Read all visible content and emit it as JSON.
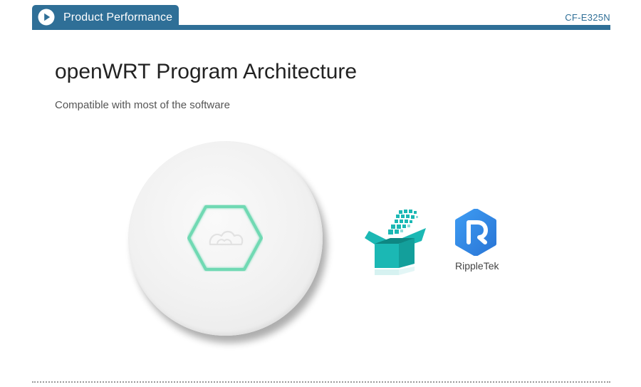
{
  "header": {
    "section_label": "Product Performance",
    "model_code": "CF-E325N"
  },
  "content": {
    "title": "openWRT Program Architecture",
    "subtitle": "Compatible with most of the software"
  },
  "software": {
    "rippletek_label": "RippleTek"
  },
  "colors": {
    "brand_blue": "#2f6f97",
    "teal": "#1bb8b4",
    "ripple_blue": "#2e86e6",
    "led_green": "#6fd9b3"
  },
  "icons": {
    "tab": "play-circle-icon",
    "device_logo": "hexagon-logo-icon",
    "openwrt": "package-box-icon",
    "rippletek": "rippletek-r-icon"
  }
}
